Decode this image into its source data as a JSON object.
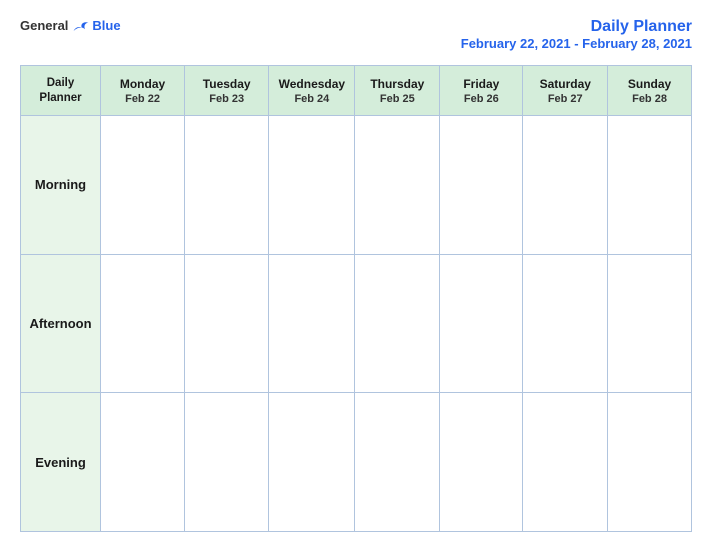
{
  "header": {
    "logo": {
      "general": "General",
      "blue": "Blue"
    },
    "title": "Daily Planner",
    "date_range": "February 22, 2021 - February 28, 2021"
  },
  "table": {
    "header_label_line1": "Daily",
    "header_label_line2": "Planner",
    "columns": [
      {
        "day": "Monday",
        "date": "Feb 22"
      },
      {
        "day": "Tuesday",
        "date": "Feb 23"
      },
      {
        "day": "Wednesday",
        "date": "Feb 24"
      },
      {
        "day": "Thursday",
        "date": "Feb 25"
      },
      {
        "day": "Friday",
        "date": "Feb 26"
      },
      {
        "day": "Saturday",
        "date": "Feb 27"
      },
      {
        "day": "Sunday",
        "date": "Feb 28"
      }
    ],
    "rows": [
      {
        "label": "Morning"
      },
      {
        "label": "Afternoon"
      },
      {
        "label": "Evening"
      }
    ]
  }
}
